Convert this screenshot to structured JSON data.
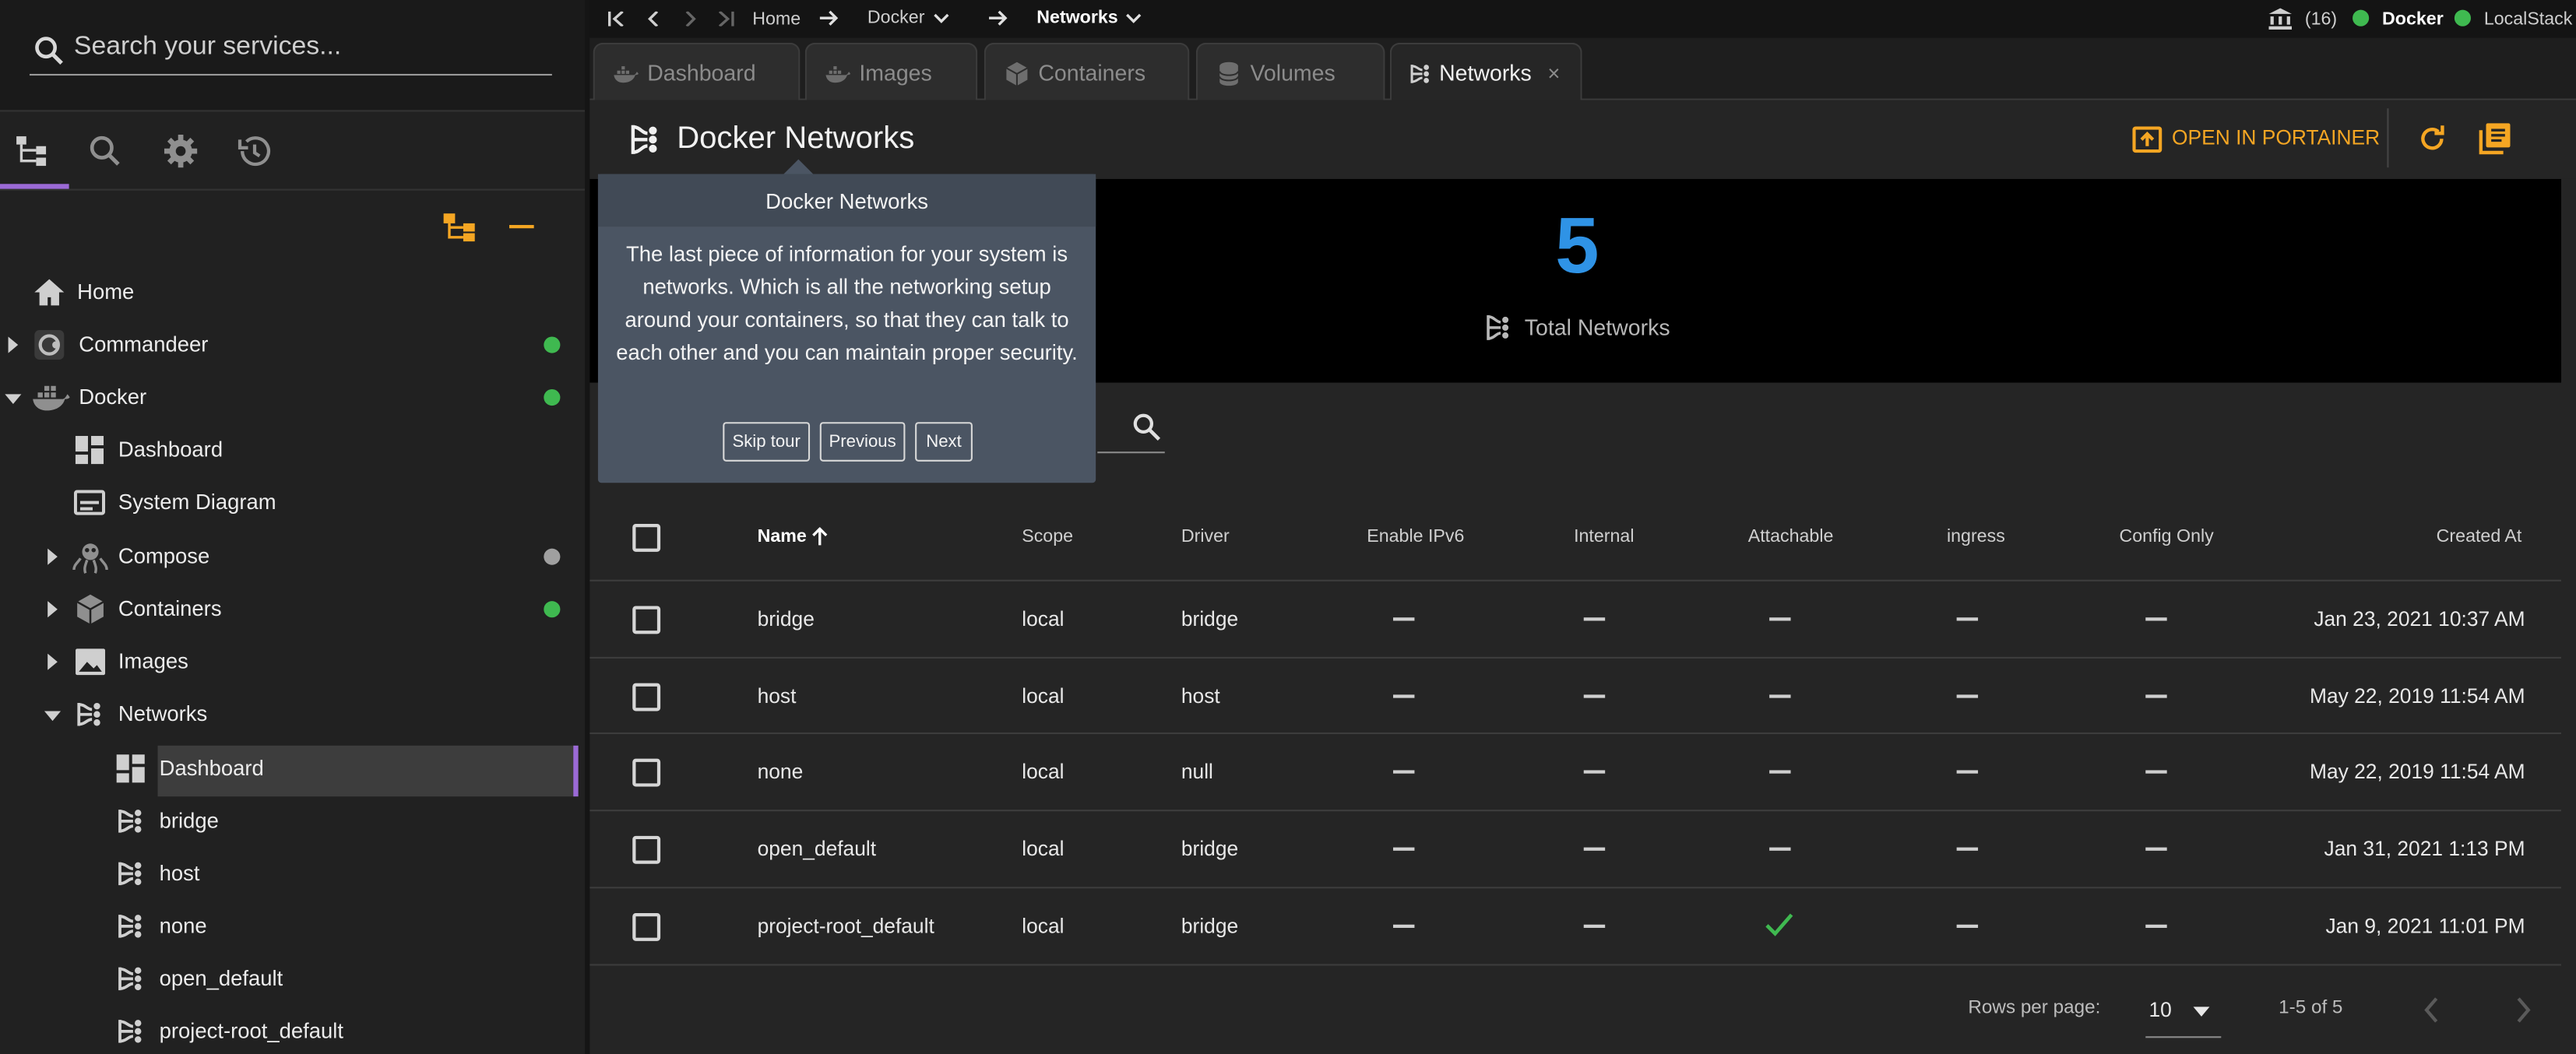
{
  "search": {
    "placeholder": "Search your services..."
  },
  "tree": {
    "home": "Home",
    "commandeer": "Commandeer",
    "docker": "Docker",
    "dashboard": "Dashboard",
    "system_diagram": "System Diagram",
    "compose": "Compose",
    "containers": "Containers",
    "images": "Images",
    "networks": "Networks",
    "net_dashboard": "Dashboard",
    "net_items": [
      "bridge",
      "host",
      "none",
      "open_default",
      "project-root_default"
    ]
  },
  "status_colors": {
    "green": "#3fb950",
    "grey": "#a0a0a0",
    "accent": "#f5a623",
    "blue": "#2f93e6"
  },
  "breadcrumb": {
    "home": "Home",
    "docker": "Docker",
    "networks": "Networks"
  },
  "topright": {
    "count": "(16)",
    "docker": "Docker",
    "localstack": "LocalStack"
  },
  "tabs": [
    {
      "label": "Dashboard"
    },
    {
      "label": "Images"
    },
    {
      "label": "Containers"
    },
    {
      "label": "Volumes"
    },
    {
      "label": "Networks",
      "close": "×"
    }
  ],
  "header": {
    "title": "Docker Networks",
    "open_portainer": "OPEN IN PORTAINER"
  },
  "stats": {
    "total": "5",
    "label": "Total Networks"
  },
  "tooltip": {
    "title": "Docker Networks",
    "body": "The last piece of information for your system is networks. Which is all the networking setup around your containers, so that they can talk to each other and you can maintain proper security.",
    "skip": "Skip tour",
    "previous": "Previous",
    "next": "Next"
  },
  "table": {
    "columns": [
      "Name",
      "Scope",
      "Driver",
      "Enable IPv6",
      "Internal",
      "Attachable",
      "ingress",
      "Config Only",
      "Created At"
    ],
    "rows": [
      {
        "name": "bridge",
        "scope": "local",
        "driver": "bridge",
        "attachable": false,
        "created": "Jan 23, 2021 10:37 AM"
      },
      {
        "name": "host",
        "scope": "local",
        "driver": "host",
        "attachable": false,
        "created": "May 22, 2019 11:54 AM"
      },
      {
        "name": "none",
        "scope": "local",
        "driver": "null",
        "attachable": false,
        "created": "May 22, 2019 11:54 AM"
      },
      {
        "name": "open_default",
        "scope": "local",
        "driver": "bridge",
        "attachable": false,
        "created": "Jan 31, 2021 1:13 PM"
      },
      {
        "name": "project-root_default",
        "scope": "local",
        "driver": "bridge",
        "attachable": true,
        "created": "Jan 9, 2021 11:01 PM"
      }
    ]
  },
  "pager": {
    "rows_per_page_label": "Rows per page:",
    "rows_per_page": "10",
    "range": "1-5 of 5"
  }
}
